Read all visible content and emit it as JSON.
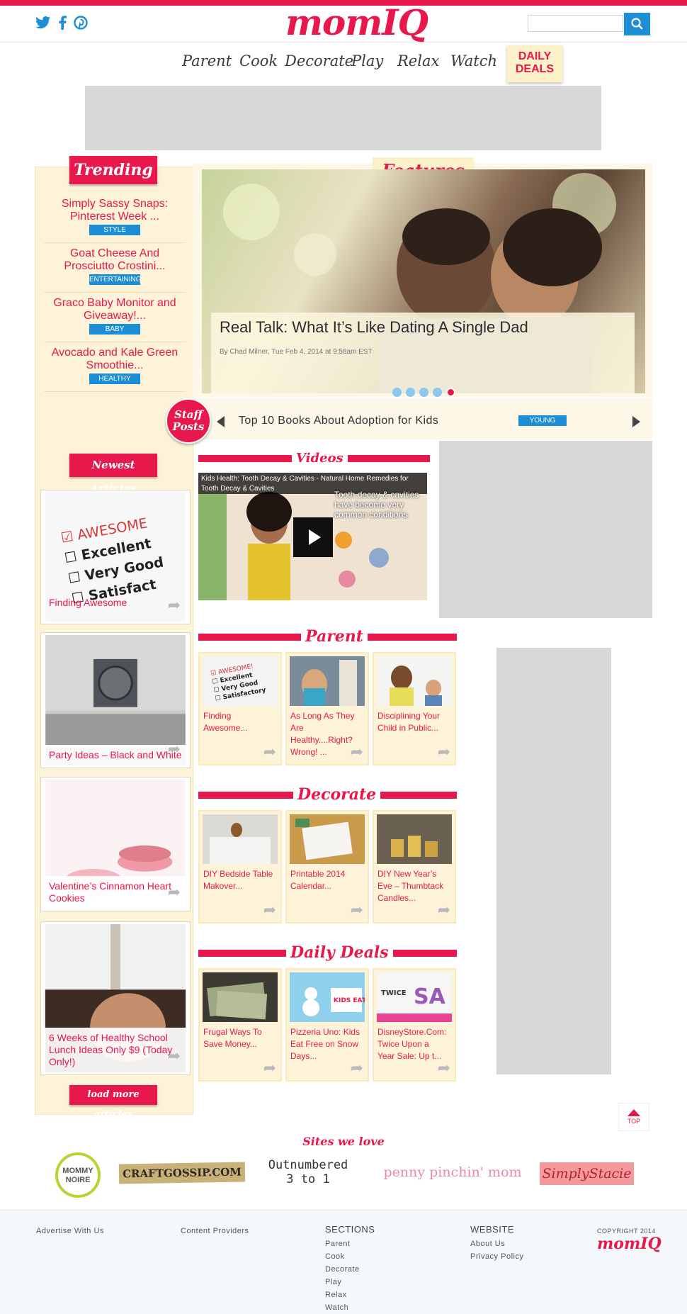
{
  "header": {
    "logo": {
      "word": "mom",
      "accent": "IQ"
    },
    "social_icons": [
      "twitter-icon",
      "facebook-icon",
      "pinterest-icon"
    ],
    "search": {
      "placeholder": "",
      "button_icon": "search-icon"
    },
    "brand_color": "#e8174c",
    "accent_blue": "#1b8ed6"
  },
  "nav": {
    "items": [
      "Parent",
      "Cook",
      "Decorate",
      "Play",
      "Relax",
      "Watch"
    ],
    "deals": {
      "line1": "DAILY",
      "line2": "DEALS"
    }
  },
  "trending": {
    "heading": "Trending",
    "items": [
      {
        "title": "Simply Sassy Snaps: Pinterest Week ...",
        "category": "STYLE"
      },
      {
        "title": "Goat Cheese And Prosciutto Crostini...",
        "category": "ENTERTAINING"
      },
      {
        "title": "Graco Baby Monitor and Giveaway!...",
        "category": "BABY"
      },
      {
        "title": "Avocado and Kale Green Smoothie...",
        "category": "HEALTHY"
      }
    ]
  },
  "features": {
    "heading": "Features",
    "headline": "Real Talk: What It’s Like Dating A Single Dad",
    "byline": "By Chad Milner, Tue Feb 4, 2014 at 9:58am EST",
    "slide_count": 5,
    "active_slide": 5
  },
  "staff_posts": {
    "badge_line1": "Staff",
    "badge_line2": "Posts",
    "title": "Top 10 Books About Adoption for Kids",
    "category": "YOUNG"
  },
  "newest": {
    "heading": "Newest Articles",
    "items": [
      {
        "title": "Finding Awesome"
      },
      {
        "title": "Party Ideas – Black and White"
      },
      {
        "title": "Valentine’s Cinnamon Heart Cookies"
      },
      {
        "title": "6 Weeks of Healthy School Lunch Ideas Only $9 (Today Only!)"
      }
    ],
    "load_more": "load more articles"
  },
  "videos": {
    "heading": "Videos",
    "title": "Kids Health: Tooth Decay & Cavities - Natural Home Remedies for Tooth Decay & Cavities",
    "overlay_text": "Tooth decay & cavities have become very common conditions"
  },
  "sections": [
    {
      "heading": "Parent",
      "cards": [
        "Finding Awesome...",
        "As Long As They Are Healthy....Right? Wrong! ...",
        "Disciplining Your Child in Public..."
      ]
    },
    {
      "heading": "Decorate",
      "cards": [
        "DIY Bedside Table Makover...",
        "Printable 2014 Calendar...",
        "DIY New Year’s Eve – Thumbtack Candles..."
      ]
    },
    {
      "heading": "Daily Deals",
      "cards": [
        "Frugal Ways To Save Money...",
        "Pizzeria Uno: Kids Eat Free on Snow Days...",
        "DisneyStore.Com: Twice Upon a Year Sale: Up t..."
      ]
    }
  ],
  "top_button": "TOP",
  "sites_we_love": {
    "heading": "Sites we love",
    "logos": [
      {
        "line1": "MOMMY",
        "line2": "NOIRE"
      },
      {
        "text": "CRAFTGOSSIP.COM"
      },
      {
        "line1": "Outnumbered",
        "line2": "3 to 1"
      },
      {
        "text": "penny pinchin' mom"
      },
      {
        "text": "SimplyStacie"
      }
    ]
  },
  "footer": {
    "advertise": "Advertise With Us",
    "content_providers": "Content Providers",
    "sections_heading": "SECTIONS",
    "sections_links": [
      "Parent",
      "Cook",
      "Decorate",
      "Play",
      "Relax",
      "Watch"
    ],
    "website_heading": "WEBSITE",
    "website_links": [
      "About Us",
      "Privacy Policy"
    ],
    "copyright": "COPYRIGHT 2014",
    "logo": {
      "word": "mom",
      "accent": "IQ"
    }
  }
}
